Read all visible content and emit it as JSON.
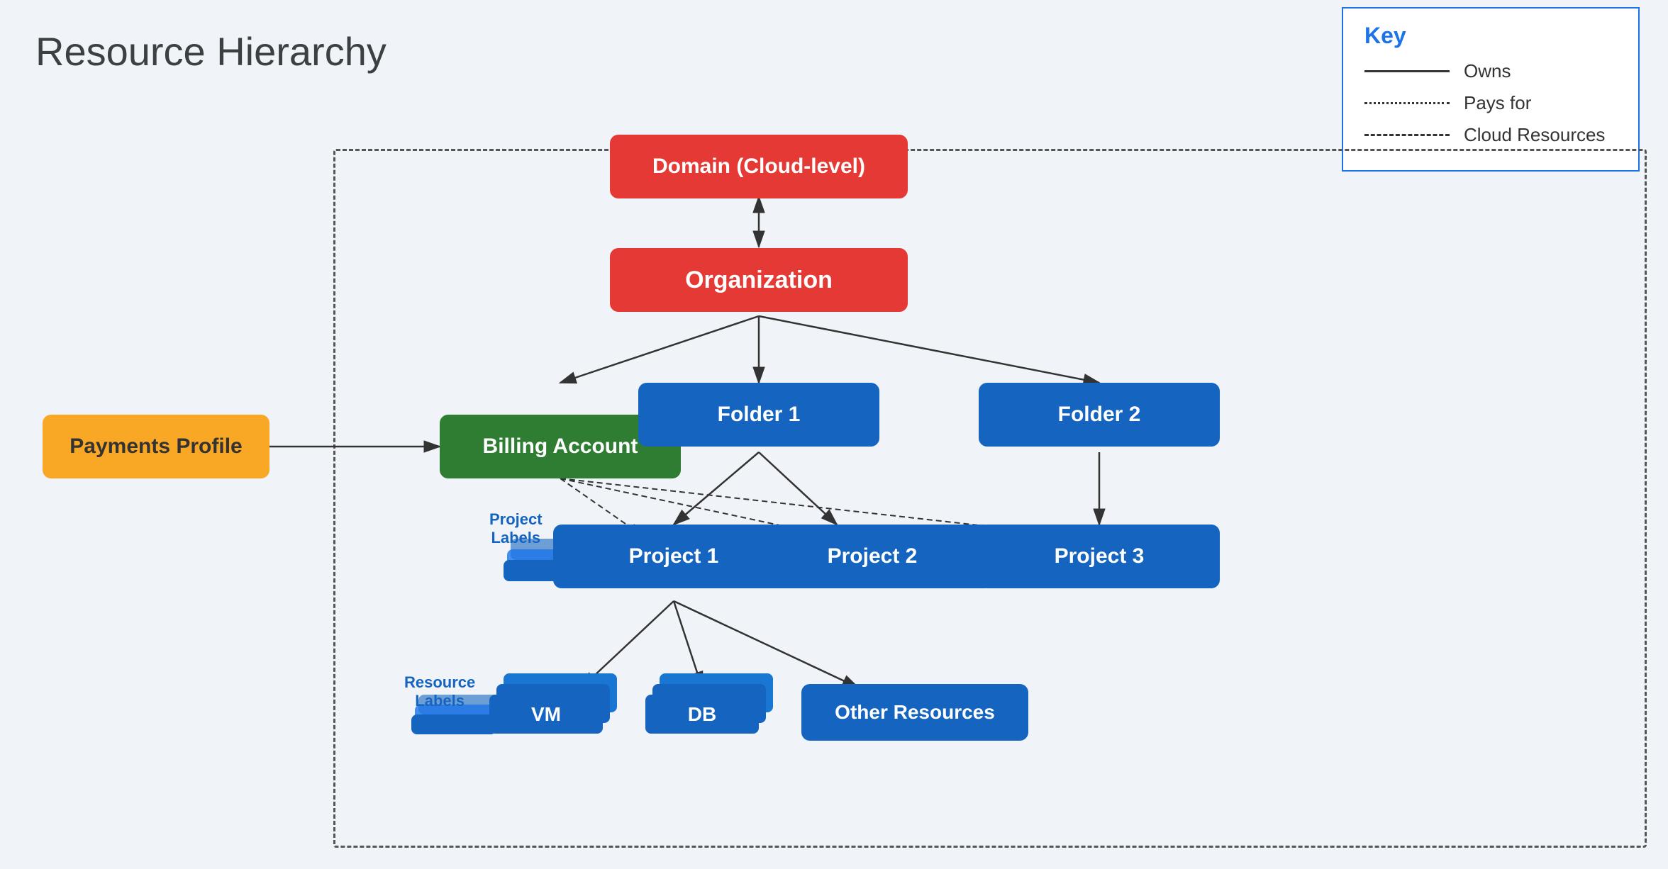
{
  "page": {
    "title": "Resource Hierarchy",
    "background": "#f0f4f8"
  },
  "key": {
    "title": "Key",
    "items": [
      {
        "line": "solid",
        "label": "Owns"
      },
      {
        "line": "dotted",
        "label": "Pays for"
      },
      {
        "line": "dashed",
        "label": "Cloud Resources"
      }
    ]
  },
  "nodes": {
    "domain": "Domain (Cloud-level)",
    "organization": "Organization",
    "billing_account": "Billing Account",
    "payments_profile": "Payments Profile",
    "folder1": "Folder 1",
    "folder2": "Folder 2",
    "project1": "Project 1",
    "project2": "Project 2",
    "project3": "Project 3",
    "vm": "VM",
    "db": "DB",
    "other_resources": "Other Resources"
  },
  "labels": {
    "project_labels": "Project\nLabels",
    "resource_labels": "Resource\nLabels"
  }
}
